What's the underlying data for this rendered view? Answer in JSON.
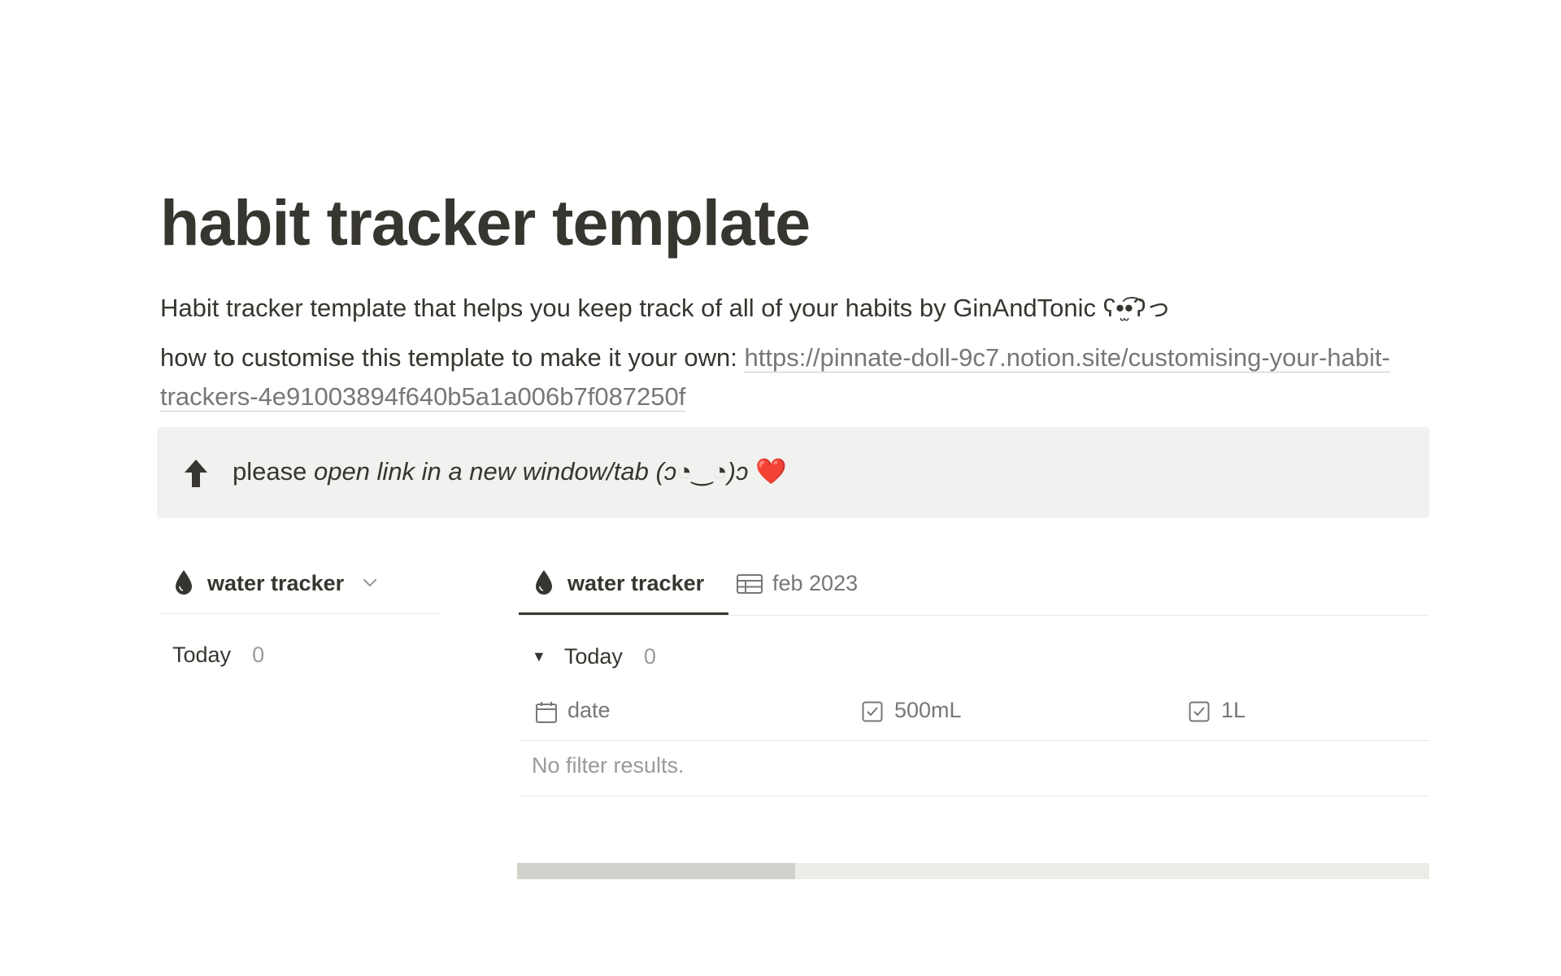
{
  "page": {
    "title": "habit tracker template",
    "description": "Habit tracker template that helps you keep track of all of your habits by GinAndTonic ʕ•̫͡•ʔっ",
    "howto_prefix": "how to customise this template to make it your own: ",
    "howto_link": "https://pinnate-doll-9c7.notion.site/customising-your-habit-trackers-4e91003894f640b5a1a006b7f087250f"
  },
  "callout": {
    "icon": "arrow-up-icon",
    "text_plain": "please ",
    "text_italic": "open link in a new window/tab (ɔ◔‿◔)ɔ",
    "emoji": "❤️"
  },
  "left_view": {
    "tab_label": "water tracker",
    "icon": "water-drop-icon",
    "group_label": "Today",
    "group_count": "0"
  },
  "right_view": {
    "tabs": [
      {
        "label": "water tracker",
        "icon": "water-drop-icon",
        "active": true
      },
      {
        "label": "feb 2023",
        "icon": "table-icon",
        "active": false
      }
    ],
    "group_label": "Today",
    "group_count": "0",
    "columns": [
      {
        "label": "date",
        "icon": "calendar-icon"
      },
      {
        "label": "500mL",
        "icon": "checkbox-icon"
      },
      {
        "label": "1L",
        "icon": "checkbox-icon"
      }
    ],
    "empty_message": "No filter results.",
    "scroll_fraction": 0.305
  },
  "colors": {
    "text": "#37352f",
    "muted": "#787774",
    "callout_bg": "#f1f1ef",
    "heart": "#e03e3e"
  }
}
